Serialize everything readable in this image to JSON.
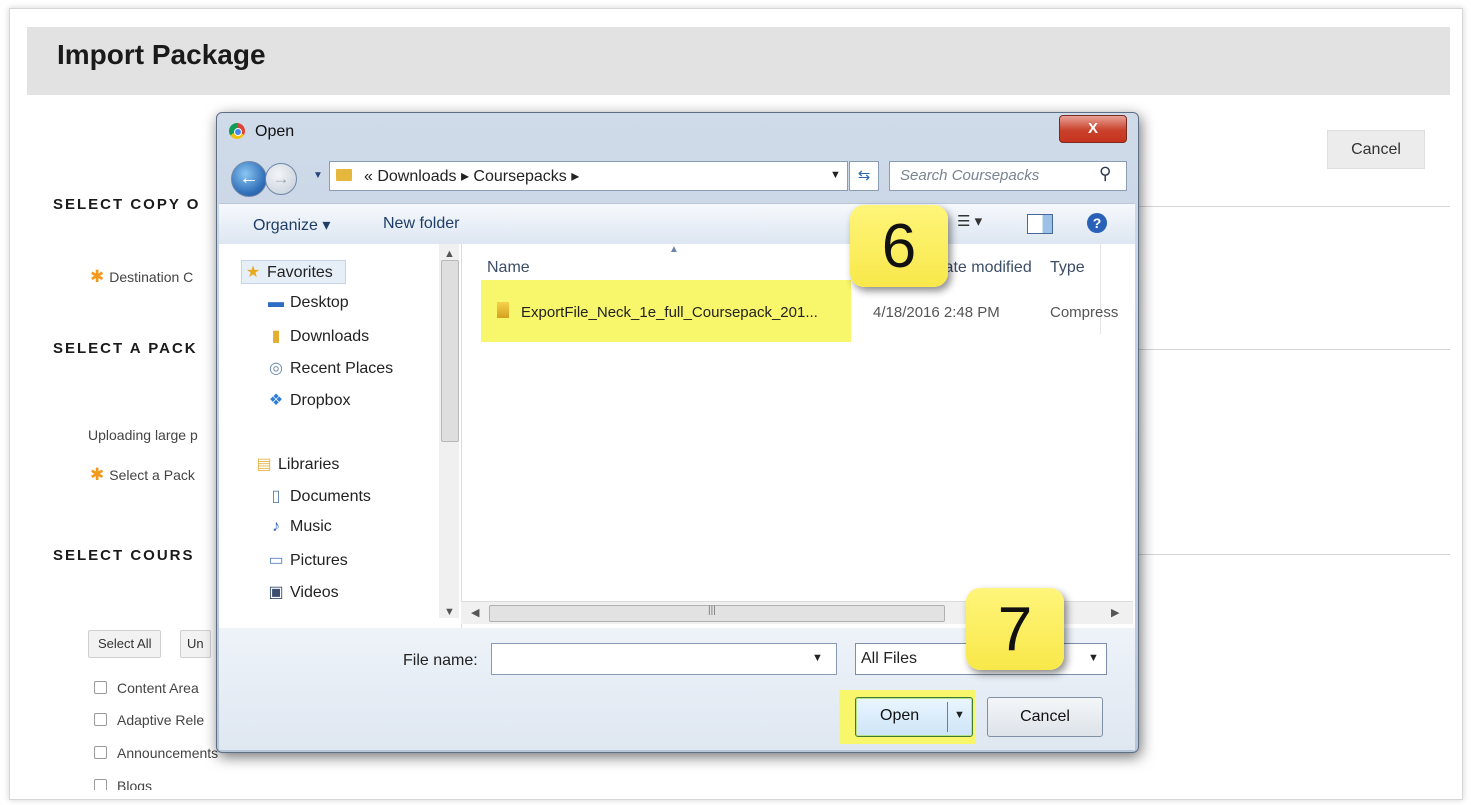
{
  "page": {
    "title": "Import Package",
    "cancel_label": "Cancel",
    "sections": {
      "copy_options": "SELECT COPY O",
      "package": "SELECT A PACK",
      "course_materials": "SELECT COURS"
    },
    "destination_label": "Destination C",
    "upload_note": "Uploading large p",
    "select_package_label": "Select a Pack",
    "select_all_label": "Select All",
    "unselect_label": "Un",
    "checkboxes": [
      "Content Area",
      "Adaptive Rele",
      "Announcements",
      "Blogs"
    ]
  },
  "dialog": {
    "title": "Open",
    "close_label": "X",
    "address": "« Downloads ▸ Coursepacks ▸",
    "search_placeholder": "Search Coursepacks",
    "toolbar": {
      "organize_label": "Organize ▾",
      "new_folder_label": "New folder"
    },
    "nav": {
      "favorites": "Favorites",
      "desktop": "Desktop",
      "downloads": "Downloads",
      "recent_places": "Recent Places",
      "dropbox": "Dropbox",
      "libraries": "Libraries",
      "documents": "Documents",
      "music": "Music",
      "pictures": "Pictures",
      "videos": "Videos"
    },
    "columns": {
      "name": "Name",
      "date_modified": "Date modified",
      "type": "Type"
    },
    "file": {
      "name": "ExportFile_Neck_1e_full_Coursepack_201...",
      "date_modified": "4/18/2016 2:48 PM",
      "type": "Compress"
    },
    "file_name_label": "File name:",
    "file_name_value": "",
    "file_type_value": "All Files",
    "open_label": "Open",
    "cancel_label": "Cancel"
  },
  "callouts": [
    "6",
    "7"
  ]
}
